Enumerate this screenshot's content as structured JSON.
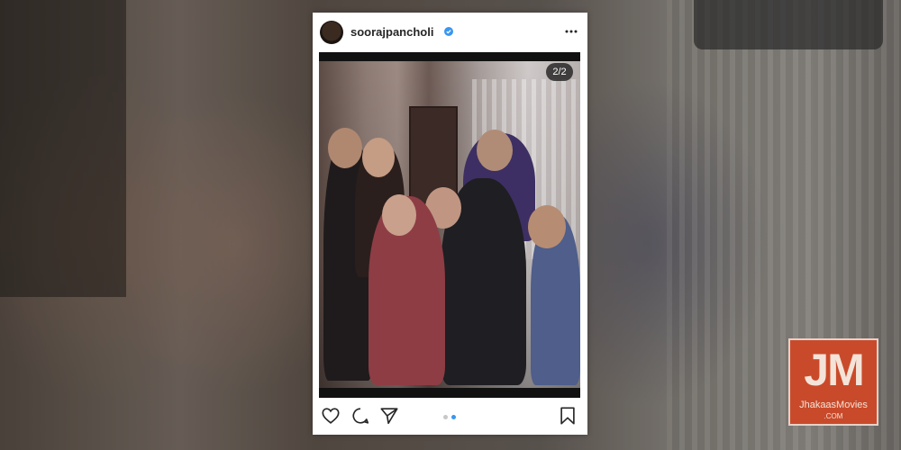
{
  "post": {
    "username": "soorajpancholi",
    "avatar_text": "",
    "image_counter": "2/2",
    "carousel": {
      "total": 2,
      "current": 2
    },
    "icons": {
      "verified": "verified-badge-icon",
      "more": "more-options-icon",
      "like": "heart-icon",
      "comment": "comment-icon",
      "share": "send-icon",
      "save": "bookmark-icon"
    }
  },
  "watermark": {
    "letters": "JM",
    "line1": "JhakaasMovies",
    "line2": ".COM"
  },
  "colors": {
    "verified": "#3897f0",
    "carousel_active": "#3897f0",
    "logo_bg": "#c94a2a"
  }
}
